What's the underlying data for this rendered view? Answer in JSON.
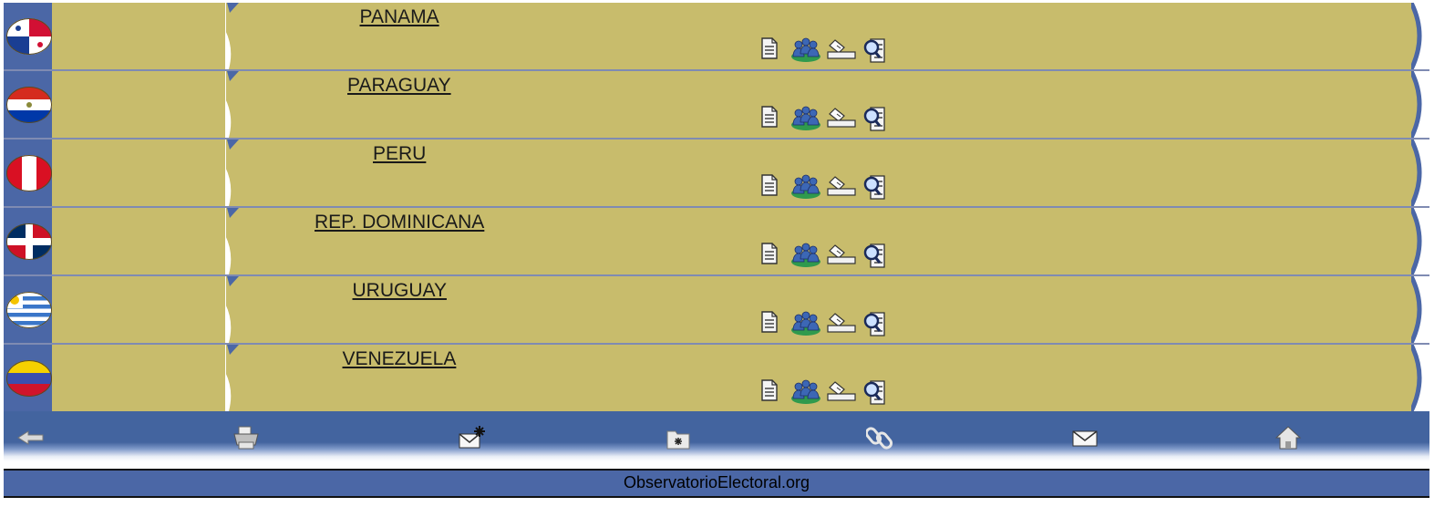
{
  "countries": [
    {
      "name": "PANAMA",
      "flag": "panama-flag-icon"
    },
    {
      "name": "PARAGUAY",
      "flag": "paraguay-flag-icon"
    },
    {
      "name": "PERU",
      "flag": "peru-flag-icon"
    },
    {
      "name": "REP. DOMINICANA",
      "flag": "dominican-republic-flag-icon"
    },
    {
      "name": "URUGUAY",
      "flag": "uruguay-flag-icon"
    },
    {
      "name": "VENEZUELA",
      "flag": "venezuela-flag-icon"
    }
  ],
  "row_actions": [
    "document-icon",
    "people-icon",
    "ballot-box-icon",
    "search-document-icon"
  ],
  "toolbar": [
    "back-arrow-icon",
    "printer-icon",
    "new-mail-icon",
    "folder-icon",
    "link-icon",
    "mail-icon",
    "home-icon"
  ],
  "footer": {
    "site": "ObservatorioElectoral.org"
  },
  "colors": {
    "row_background": "#c8bc6c",
    "bar_blue": "#43649f",
    "footer_blue": "#4b67a6"
  }
}
